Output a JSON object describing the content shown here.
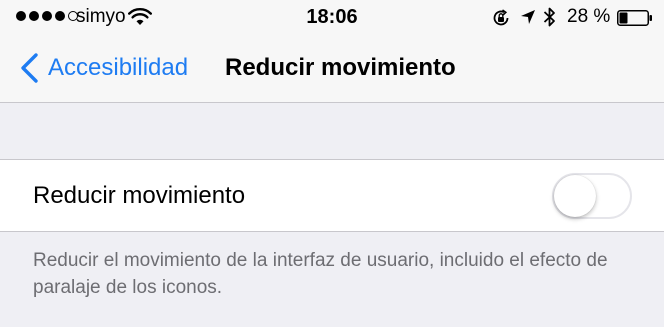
{
  "status_bar": {
    "signal_bars_filled": 4,
    "signal_bars_total": 5,
    "carrier": "simyo",
    "time": "18:06",
    "battery_percent": "28 %",
    "icons": [
      "wifi-icon",
      "rotation-lock-icon",
      "location-arrow-icon",
      "bluetooth-icon",
      "battery-icon"
    ]
  },
  "nav": {
    "back_label": "Accesibilidad",
    "title": "Reducir movimiento"
  },
  "setting": {
    "label": "Reducir movimiento",
    "enabled": false
  },
  "footer": {
    "text": "Reducir el movimiento de la interfaz de usuario, incluido el efecto de paralaje de los iconos."
  },
  "colors": {
    "accent": "#1e7cf2",
    "background": "#efeff4",
    "bar": "#f7f7f7",
    "footer_text": "#6d6d72"
  }
}
